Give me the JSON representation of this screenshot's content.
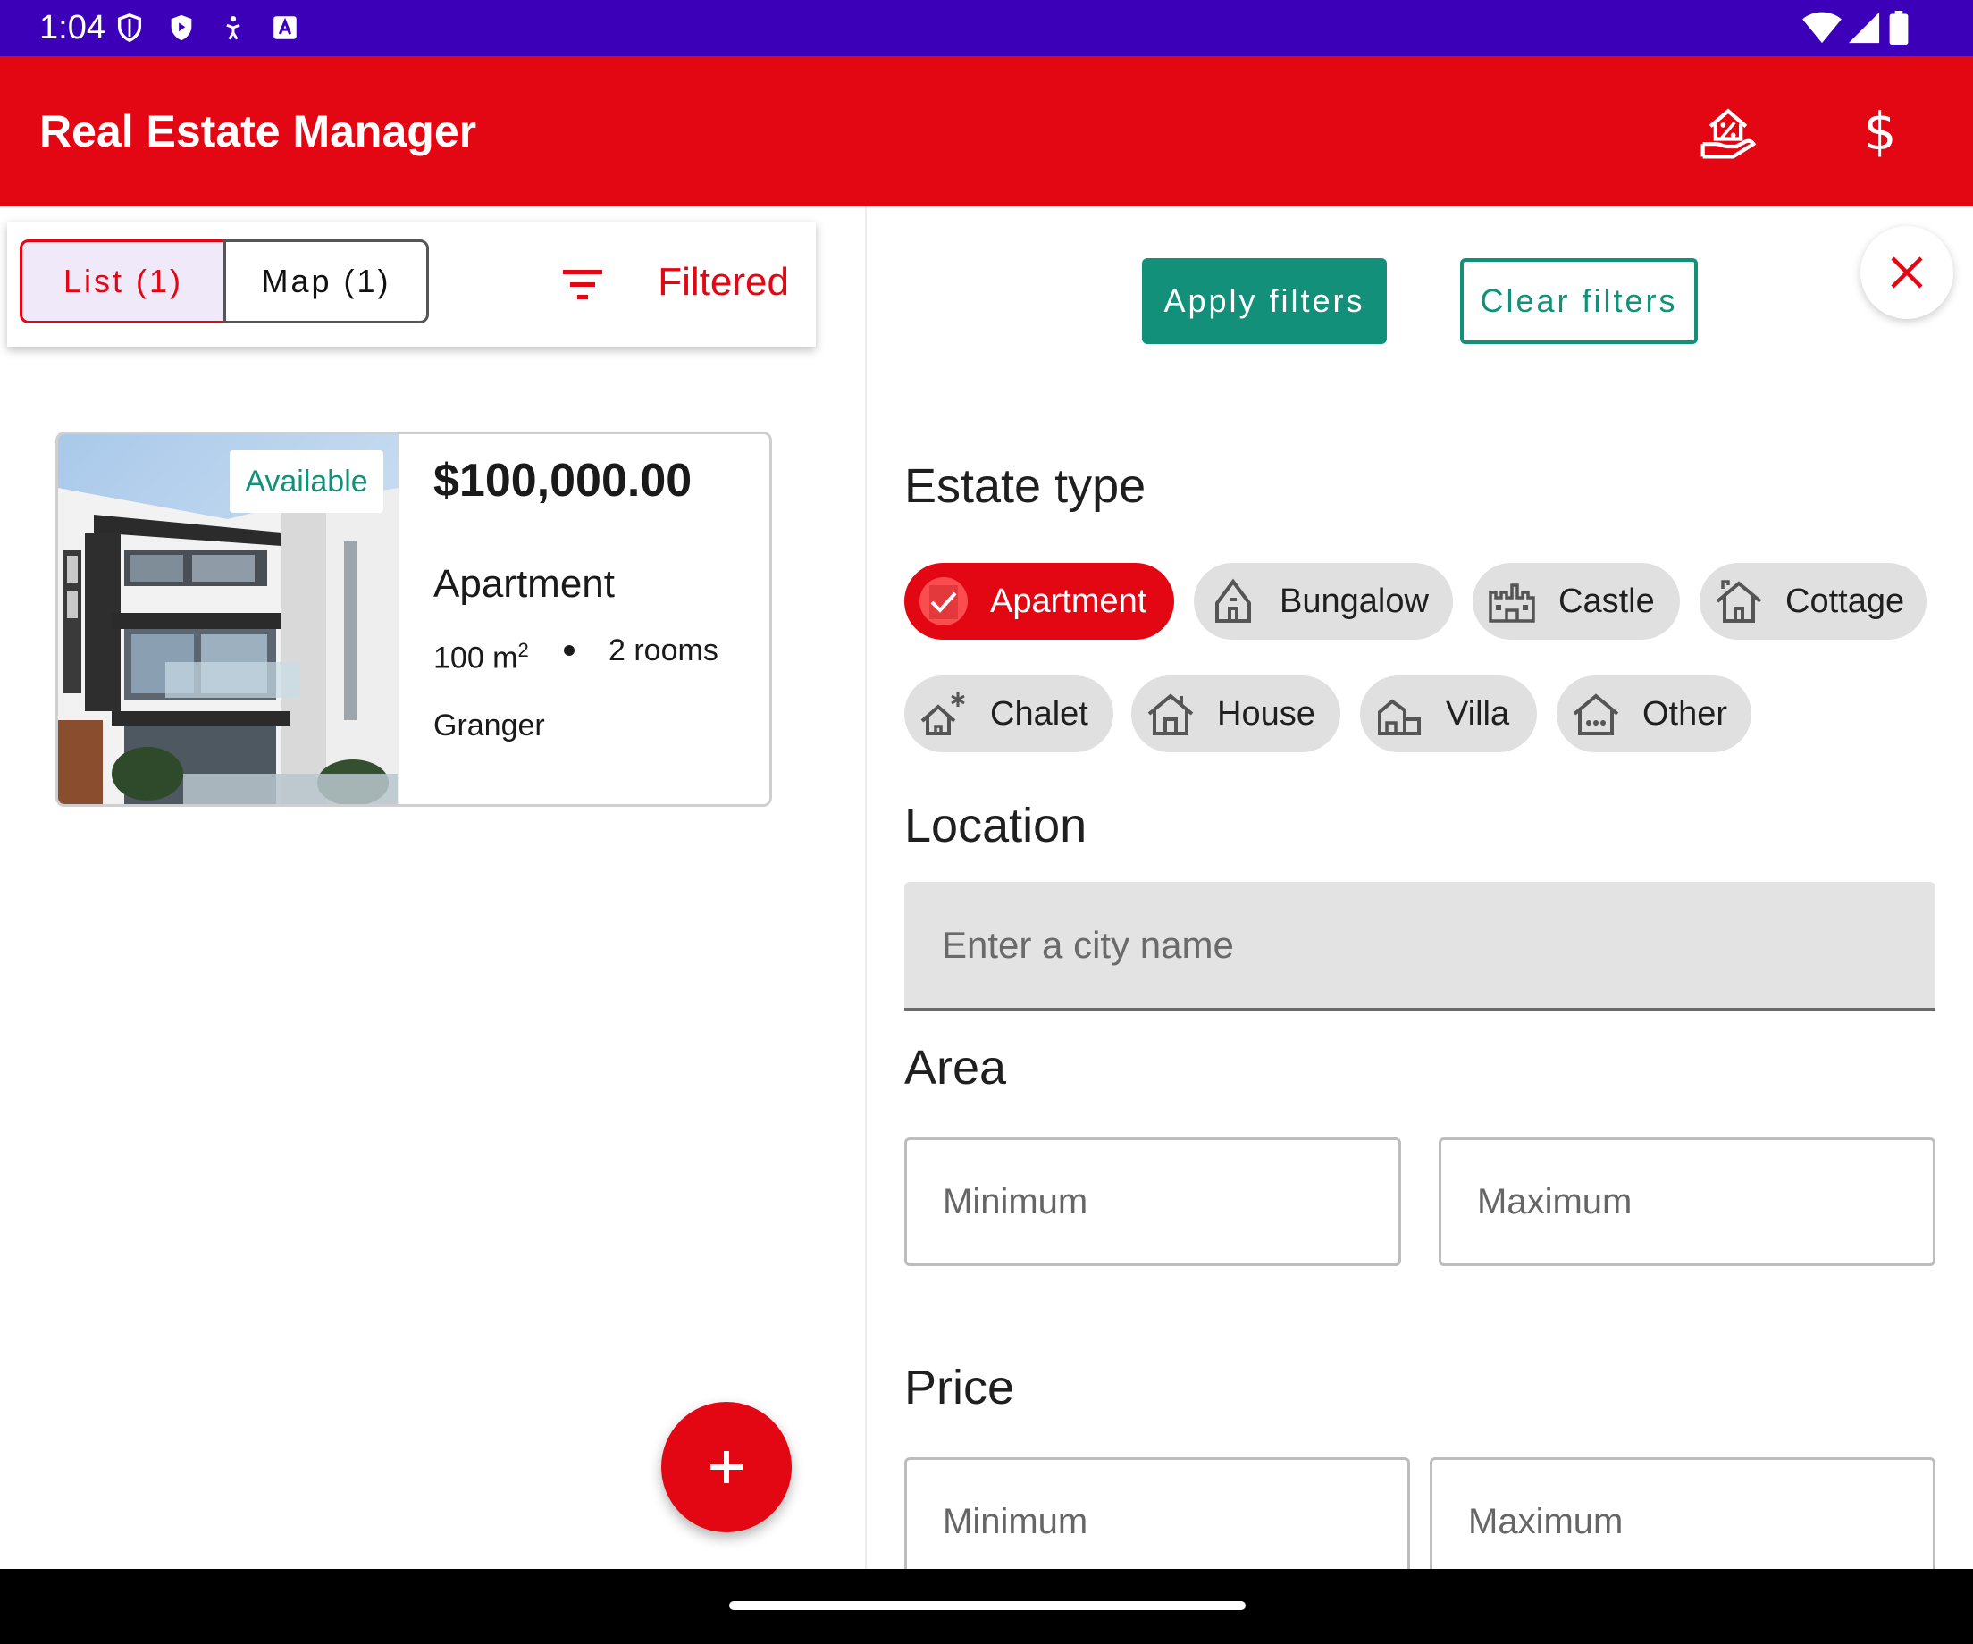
{
  "status_bar": {
    "time": "1:04",
    "icons": [
      "shield-icon",
      "play-protect-icon",
      "accessibility-icon",
      "keyboard-a-icon"
    ],
    "right_icons": [
      "wifi-icon",
      "signal-icon",
      "battery-icon"
    ]
  },
  "app_bar": {
    "title": "Real Estate Manager",
    "actions": [
      "loan-simulator-icon",
      "currency-dollar-icon"
    ],
    "dollar_symbol": "$"
  },
  "colors": {
    "primary": "#e30613",
    "status_bar": "#3c00b8",
    "accent": "#12907a",
    "chip_bg": "#e0e0e0"
  },
  "left_pane": {
    "tabs": [
      {
        "label": "List (1)",
        "selected": true
      },
      {
        "label": "Map (1)",
        "selected": false
      }
    ],
    "filter_icon": "filter-list-icon",
    "filter_status": "Filtered",
    "listing": {
      "status": "Available",
      "price": "$100,000.00",
      "type": "Apartment",
      "area_value": "100 m",
      "area_unit_sup": "2",
      "rooms": "2 rooms",
      "city": "Granger"
    },
    "fab_icon": "add-icon"
  },
  "filters": {
    "apply_label": "Apply filters",
    "clear_label": "Clear filters",
    "close_icon": "close-icon",
    "estate_type": {
      "title": "Estate type",
      "chips": [
        {
          "label": "Apartment",
          "icon": "apartment-icon",
          "selected": true
        },
        {
          "label": "Bungalow",
          "icon": "bungalow-icon",
          "selected": false
        },
        {
          "label": "Castle",
          "icon": "castle-icon",
          "selected": false
        },
        {
          "label": "Cottage",
          "icon": "cottage-icon",
          "selected": false
        },
        {
          "label": "Chalet",
          "icon": "chalet-icon",
          "selected": false
        },
        {
          "label": "House",
          "icon": "house-icon",
          "selected": false
        },
        {
          "label": "Villa",
          "icon": "villa-icon",
          "selected": false
        },
        {
          "label": "Other",
          "icon": "other-home-icon",
          "selected": false
        }
      ]
    },
    "location": {
      "title": "Location",
      "placeholder": "Enter a city name",
      "value": ""
    },
    "area": {
      "title": "Area",
      "min_placeholder": "Minimum",
      "max_placeholder": "Maximum"
    },
    "price": {
      "title": "Price",
      "min_placeholder": "Minimum",
      "max_placeholder": "Maximum"
    }
  }
}
